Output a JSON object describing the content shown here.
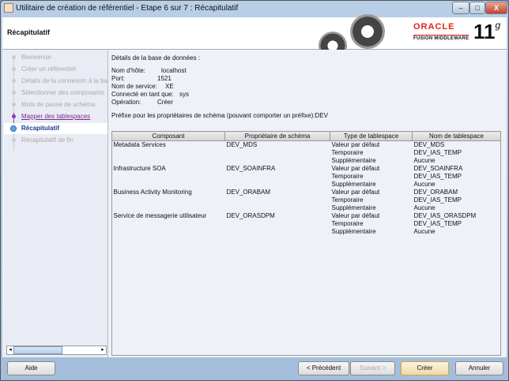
{
  "window": {
    "title": "Utilitaire de création de référentiel - Etape 6 sur 7 : Récapitulatif",
    "minimize": "–",
    "maximize": "□",
    "close": "X"
  },
  "header": {
    "title": "Récapitulatif",
    "brand": "ORACLE",
    "product": "FUSION MIDDLEWARE",
    "version": "11",
    "version_suffix": "g"
  },
  "steps": [
    {
      "label": "Bienvenue",
      "state": "pending"
    },
    {
      "label": "Créer un référentiel",
      "state": "pending"
    },
    {
      "label": "Détails de la connexion à la base",
      "state": "pending"
    },
    {
      "label": "Sélectionner des composants",
      "state": "pending"
    },
    {
      "label": "Mots de passe de schéma",
      "state": "pending"
    },
    {
      "label": "Mapper des tablespaces",
      "state": "done"
    },
    {
      "label": "Récapitulatif",
      "state": "current"
    },
    {
      "label": "Récapitulatif de fin",
      "state": "pending"
    }
  ],
  "details": {
    "heading": "Détails de la base de données :",
    "host_label": "Nom d'hôte:",
    "host": "localhost",
    "port_label": "Port:",
    "port": "1521",
    "service_label": "Nom de service:",
    "service": "XE",
    "user_label": "Connecté en tant que:",
    "user": "sys",
    "op_label": "Opération:",
    "op": "Créer",
    "prefix": "Préfixe pour les propriétaires de schéma (pouvant comporter un préfixe):DEV"
  },
  "table": {
    "headers": [
      "Composant",
      "Propriétaire de schéma",
      "Type de tablespace",
      "Nom de tablespace"
    ],
    "rows": [
      [
        "Metadata Services",
        "DEV_MDS",
        "Valeur par défaut",
        "DEV_MDS"
      ],
      [
        "",
        "",
        "Temporaire",
        "DEV_IAS_TEMP"
      ],
      [
        "",
        "",
        "Supplémentaire",
        "Aucune"
      ],
      [
        "Infrastructure SOA",
        "DEV_SOAINFRA",
        "Valeur par défaut",
        "DEV_SOAINFRA"
      ],
      [
        "",
        "",
        "Temporaire",
        "DEV_IAS_TEMP"
      ],
      [
        "",
        "",
        "Supplémentaire",
        "Aucune"
      ],
      [
        "Business Activity Monitoring",
        "DEV_ORABAM",
        "Valeur par défaut",
        "DEV_ORABAM"
      ],
      [
        "",
        "",
        "Temporaire",
        "DEV_IAS_TEMP"
      ],
      [
        "",
        "",
        "Supplémentaire",
        "Aucune"
      ],
      [
        "Service de messagerie utilisateur",
        "DEV_ORASDPM",
        "Valeur par défaut",
        "DEV_IAS_ORASDPM"
      ],
      [
        "",
        "",
        "Temporaire",
        "DEV_IAS_TEMP"
      ],
      [
        "",
        "",
        "Supplémentaire",
        "Aucune"
      ]
    ]
  },
  "buttons": {
    "help": "Aide",
    "prev": "< Précédent",
    "next": "Suivant >",
    "create": "Créer",
    "cancel": "Annuler"
  }
}
